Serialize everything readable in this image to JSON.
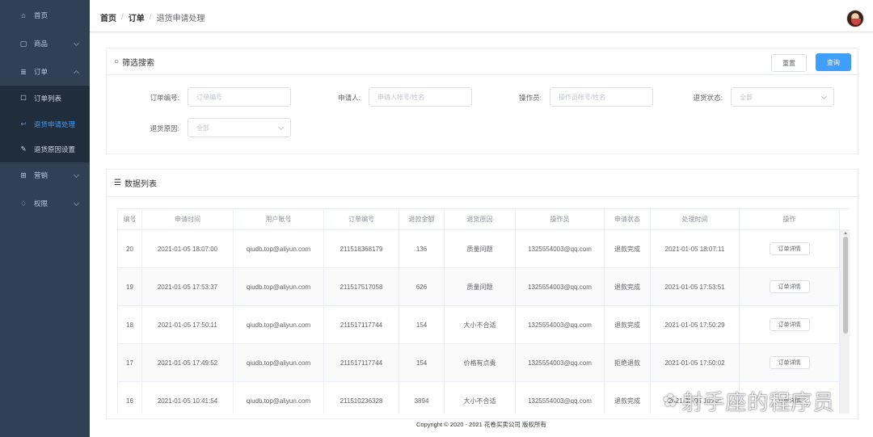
{
  "sidebar": {
    "items": [
      {
        "label": "首页",
        "icon": "home-icon"
      },
      {
        "label": "商品",
        "icon": "shop-icon"
      },
      {
        "label": "订单",
        "icon": "order-icon"
      },
      {
        "label": "营销",
        "icon": "gift-icon"
      },
      {
        "label": "权限",
        "icon": "bell-icon"
      }
    ],
    "order_sub": [
      {
        "label": "订单列表",
        "icon": "edit-icon"
      },
      {
        "label": "退货申请处理",
        "icon": "return-icon"
      },
      {
        "label": "退货原因设置",
        "icon": "settings-edit-icon"
      }
    ],
    "active_color": "#409eff",
    "bg_color": "#304156"
  },
  "header": {
    "breadcrumb": [
      "首页",
      "订单",
      "退货申请处理"
    ]
  },
  "filter": {
    "title": "筛选搜索",
    "reset_label": "重置",
    "search_label": "查询",
    "fields": {
      "order_no": {
        "label": "订单编号:",
        "placeholder": "订单编号"
      },
      "applicant": {
        "label": "申请人:",
        "placeholder": "申请人帐号/姓名"
      },
      "operator": {
        "label": "操作员:",
        "placeholder": "操作员帐号/姓名"
      },
      "status": {
        "label": "退货状态:",
        "value": "全部"
      },
      "reason": {
        "label": "退货原因:",
        "value": "全部"
      }
    }
  },
  "list": {
    "title": "数据列表",
    "columns": [
      "编号",
      "申请时间",
      "用户帐号",
      "订单编号",
      "退款金额",
      "退货原因",
      "操作员",
      "申请状态",
      "处理时间",
      "操作"
    ],
    "action_label": "订单详情",
    "rows": [
      [
        "20",
        "2021-01-05 18:07:00",
        "qiudb.top@aliyun.com",
        "211518368179",
        "136",
        "质量问题",
        "1325554003@qq.com",
        "退款完成",
        "2021-01-05 18:07:11"
      ],
      [
        "19",
        "2021-01-05 17:53:37",
        "qiudb.top@aliyun.com",
        "211517517058",
        "626",
        "质量问题",
        "1325554003@qq.com",
        "退款完成",
        "2021-01-05 17:53:51"
      ],
      [
        "18",
        "2021-01-05 17:50:11",
        "qiudb.top@aliyun.com",
        "211517117744",
        "154",
        "大小不合适",
        "1325554003@qq.com",
        "退款完成",
        "2021-01-05 17:50:29"
      ],
      [
        "17",
        "2021-01-05 17:49:52",
        "qiudb.top@aliyun.com",
        "211517117744",
        "154",
        "价格有点贵",
        "1325554003@qq.com",
        "拒绝退款",
        "2021-01-05 17:50:02"
      ],
      [
        "16",
        "2021-01-05 10:41:54",
        "qiudb.top@aliyun.com",
        "211510236328",
        "3894",
        "大小不合适",
        "1325554003@qq.com",
        "退款完成",
        "2021-01-05 10:42:"
      ]
    ]
  },
  "footer": {
    "text": "Copyright © 2020 - 2021 花卷买卖公司 版权所有"
  },
  "watermark": {
    "text": "射手座的程序员"
  }
}
